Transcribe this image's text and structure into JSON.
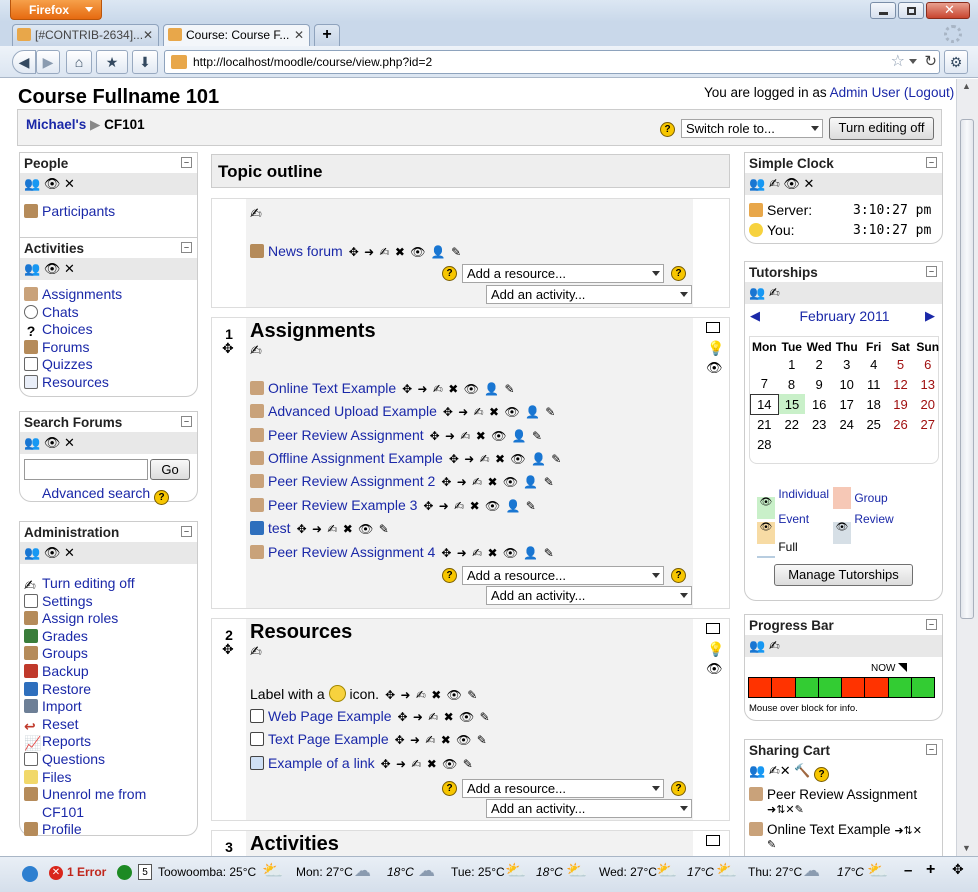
{
  "browser": {
    "menu_button": "Firefox",
    "tabs": [
      {
        "label": "[#CONTRIB-2634]..."
      },
      {
        "label": "Course: Course F..."
      }
    ],
    "new_tab": "+",
    "url": "http://localhost/moodle/course/view.php?id=2"
  },
  "header": {
    "course_title": "Course Fullname 101",
    "login_prefix": "You are logged in as",
    "user": "Admin User",
    "logout": "(Logout)",
    "breadcrumb": [
      "Michael's",
      "CF101"
    ],
    "switch_role": "Switch role to...",
    "editing_button": "Turn editing off"
  },
  "people": {
    "title": "People",
    "items": [
      "Participants"
    ]
  },
  "activities": {
    "title": "Activities",
    "items": [
      "Assignments",
      "Chats",
      "Choices",
      "Forums",
      "Quizzes",
      "Resources"
    ]
  },
  "search_forums": {
    "title": "Search Forums",
    "go": "Go",
    "advanced": "Advanced search"
  },
  "administration": {
    "title": "Administration",
    "items": [
      "Turn editing off",
      "Settings",
      "Assign roles",
      "Grades",
      "Groups",
      "Backup",
      "Restore",
      "Import",
      "Reset",
      "Reports",
      "Questions",
      "Files",
      "Unenrol me from",
      "CF101",
      "Profile"
    ]
  },
  "topic_outline": {
    "title": "Topic outline",
    "add_resource": "Add a resource...",
    "add_activity": "Add an activity...",
    "section0": {
      "items": [
        "News forum"
      ]
    },
    "section1": {
      "num": "1",
      "title": "Assignments",
      "items": [
        "Online Text Example",
        "Advanced Upload Example",
        "Peer Review Assignment",
        "Offline Assignment Example",
        "Peer Review Assignment 2",
        "Peer Review Example 3",
        "test",
        "Peer Review Assignment 4"
      ]
    },
    "section2": {
      "num": "2",
      "title": "Resources",
      "label_pre": "Label with a",
      "label_post": "icon.",
      "items": [
        "Web Page Example",
        "Text Page Example",
        "Example of a link"
      ]
    },
    "section3": {
      "num": "3",
      "title": "Activities"
    }
  },
  "simple_clock": {
    "title": "Simple Clock",
    "server_label": "Server:",
    "server_time": "3:10:27 pm",
    "you_label": "You:",
    "you_time": "3:10:27 pm"
  },
  "tutorships": {
    "title": "Tutorships",
    "month": "February 2011",
    "days": [
      "Mon",
      "Tue",
      "Wed",
      "Thu",
      "Fri",
      "Sat",
      "Sun"
    ],
    "weeks": [
      [
        "",
        "1",
        "2",
        "3",
        "4",
        "5",
        "6"
      ],
      [
        "7",
        "8",
        "9",
        "10",
        "11",
        "12",
        "13"
      ],
      [
        "14",
        "15",
        "16",
        "17",
        "18",
        "19",
        "20"
      ],
      [
        "21",
        "22",
        "23",
        "24",
        "25",
        "26",
        "27"
      ],
      [
        "28",
        "",
        "",
        "",
        "",
        "",
        ""
      ]
    ],
    "legend": [
      "Individual",
      "Group",
      "Event",
      "Review",
      "Full"
    ],
    "manage": "Manage Tutorships"
  },
  "progress_bar": {
    "title": "Progress Bar",
    "now": "NOW",
    "info": "Mouse over block for info.",
    "cells": [
      "red",
      "red",
      "green",
      "green",
      "red",
      "red",
      "green",
      "green"
    ]
  },
  "sharing_cart": {
    "title": "Sharing Cart",
    "items": [
      "Peer Review Assignment",
      "Online Text Example"
    ]
  },
  "statusbar": {
    "errors": "1 Error",
    "weather": [
      "Toowoomba: 25°C",
      "Mon: 27°C",
      "18°C",
      "Tue: 25°C",
      "18°C",
      "Wed: 27°C",
      "17°C",
      "Thu: 27°C",
      "17°C"
    ]
  },
  "colors": {
    "link": "#1a28a8",
    "block_icon_bar": "#e8e8e8",
    "progress_red": "#ff3300",
    "progress_green": "#33cc33"
  }
}
